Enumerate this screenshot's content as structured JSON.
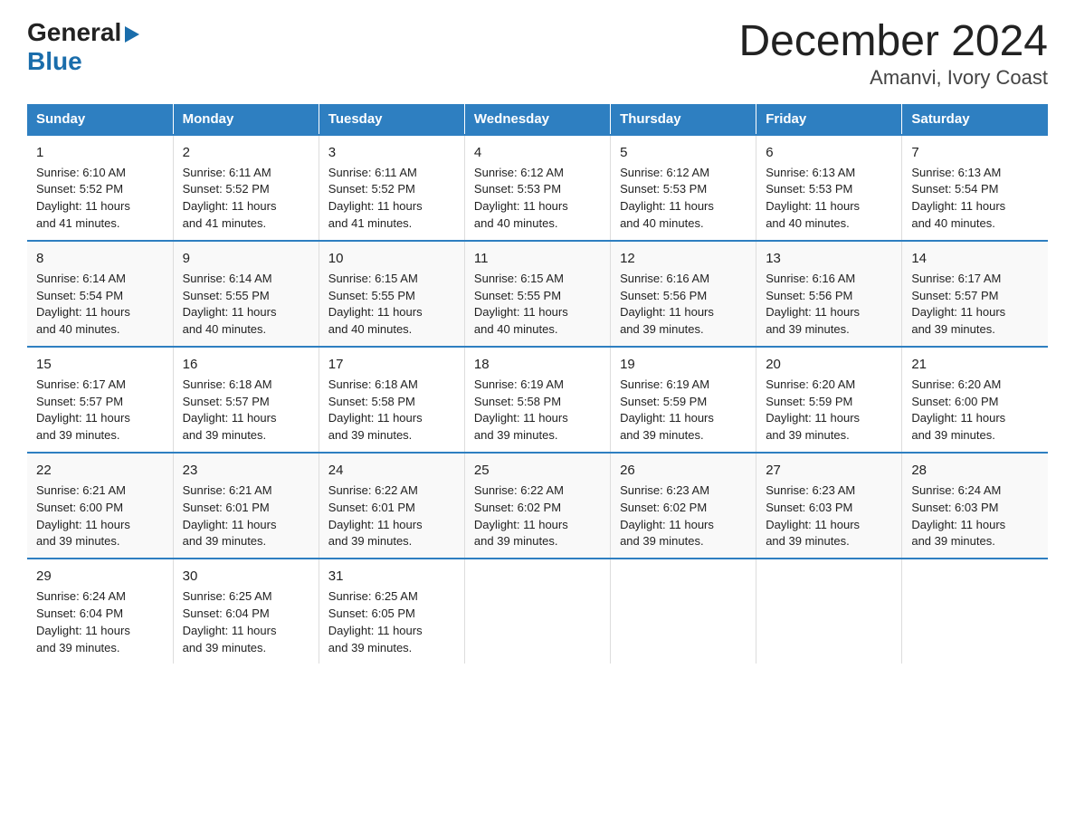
{
  "logo": {
    "general": "General",
    "blue": "Blue"
  },
  "title": "December 2024",
  "subtitle": "Amanvi, Ivory Coast",
  "days_of_week": [
    "Sunday",
    "Monday",
    "Tuesday",
    "Wednesday",
    "Thursday",
    "Friday",
    "Saturday"
  ],
  "weeks": [
    [
      {
        "day": "1",
        "sunrise": "6:10 AM",
        "sunset": "5:52 PM",
        "daylight": "11 hours and 41 minutes."
      },
      {
        "day": "2",
        "sunrise": "6:11 AM",
        "sunset": "5:52 PM",
        "daylight": "11 hours and 41 minutes."
      },
      {
        "day": "3",
        "sunrise": "6:11 AM",
        "sunset": "5:52 PM",
        "daylight": "11 hours and 41 minutes."
      },
      {
        "day": "4",
        "sunrise": "6:12 AM",
        "sunset": "5:53 PM",
        "daylight": "11 hours and 40 minutes."
      },
      {
        "day": "5",
        "sunrise": "6:12 AM",
        "sunset": "5:53 PM",
        "daylight": "11 hours and 40 minutes."
      },
      {
        "day": "6",
        "sunrise": "6:13 AM",
        "sunset": "5:53 PM",
        "daylight": "11 hours and 40 minutes."
      },
      {
        "day": "7",
        "sunrise": "6:13 AM",
        "sunset": "5:54 PM",
        "daylight": "11 hours and 40 minutes."
      }
    ],
    [
      {
        "day": "8",
        "sunrise": "6:14 AM",
        "sunset": "5:54 PM",
        "daylight": "11 hours and 40 minutes."
      },
      {
        "day": "9",
        "sunrise": "6:14 AM",
        "sunset": "5:55 PM",
        "daylight": "11 hours and 40 minutes."
      },
      {
        "day": "10",
        "sunrise": "6:15 AM",
        "sunset": "5:55 PM",
        "daylight": "11 hours and 40 minutes."
      },
      {
        "day": "11",
        "sunrise": "6:15 AM",
        "sunset": "5:55 PM",
        "daylight": "11 hours and 40 minutes."
      },
      {
        "day": "12",
        "sunrise": "6:16 AM",
        "sunset": "5:56 PM",
        "daylight": "11 hours and 39 minutes."
      },
      {
        "day": "13",
        "sunrise": "6:16 AM",
        "sunset": "5:56 PM",
        "daylight": "11 hours and 39 minutes."
      },
      {
        "day": "14",
        "sunrise": "6:17 AM",
        "sunset": "5:57 PM",
        "daylight": "11 hours and 39 minutes."
      }
    ],
    [
      {
        "day": "15",
        "sunrise": "6:17 AM",
        "sunset": "5:57 PM",
        "daylight": "11 hours and 39 minutes."
      },
      {
        "day": "16",
        "sunrise": "6:18 AM",
        "sunset": "5:57 PM",
        "daylight": "11 hours and 39 minutes."
      },
      {
        "day": "17",
        "sunrise": "6:18 AM",
        "sunset": "5:58 PM",
        "daylight": "11 hours and 39 minutes."
      },
      {
        "day": "18",
        "sunrise": "6:19 AM",
        "sunset": "5:58 PM",
        "daylight": "11 hours and 39 minutes."
      },
      {
        "day": "19",
        "sunrise": "6:19 AM",
        "sunset": "5:59 PM",
        "daylight": "11 hours and 39 minutes."
      },
      {
        "day": "20",
        "sunrise": "6:20 AM",
        "sunset": "5:59 PM",
        "daylight": "11 hours and 39 minutes."
      },
      {
        "day": "21",
        "sunrise": "6:20 AM",
        "sunset": "6:00 PM",
        "daylight": "11 hours and 39 minutes."
      }
    ],
    [
      {
        "day": "22",
        "sunrise": "6:21 AM",
        "sunset": "6:00 PM",
        "daylight": "11 hours and 39 minutes."
      },
      {
        "day": "23",
        "sunrise": "6:21 AM",
        "sunset": "6:01 PM",
        "daylight": "11 hours and 39 minutes."
      },
      {
        "day": "24",
        "sunrise": "6:22 AM",
        "sunset": "6:01 PM",
        "daylight": "11 hours and 39 minutes."
      },
      {
        "day": "25",
        "sunrise": "6:22 AM",
        "sunset": "6:02 PM",
        "daylight": "11 hours and 39 minutes."
      },
      {
        "day": "26",
        "sunrise": "6:23 AM",
        "sunset": "6:02 PM",
        "daylight": "11 hours and 39 minutes."
      },
      {
        "day": "27",
        "sunrise": "6:23 AM",
        "sunset": "6:03 PM",
        "daylight": "11 hours and 39 minutes."
      },
      {
        "day": "28",
        "sunrise": "6:24 AM",
        "sunset": "6:03 PM",
        "daylight": "11 hours and 39 minutes."
      }
    ],
    [
      {
        "day": "29",
        "sunrise": "6:24 AM",
        "sunset": "6:04 PM",
        "daylight": "11 hours and 39 minutes."
      },
      {
        "day": "30",
        "sunrise": "6:25 AM",
        "sunset": "6:04 PM",
        "daylight": "11 hours and 39 minutes."
      },
      {
        "day": "31",
        "sunrise": "6:25 AM",
        "sunset": "6:05 PM",
        "daylight": "11 hours and 39 minutes."
      },
      null,
      null,
      null,
      null
    ]
  ],
  "labels": {
    "sunrise": "Sunrise:",
    "sunset": "Sunset:",
    "daylight": "Daylight:"
  }
}
